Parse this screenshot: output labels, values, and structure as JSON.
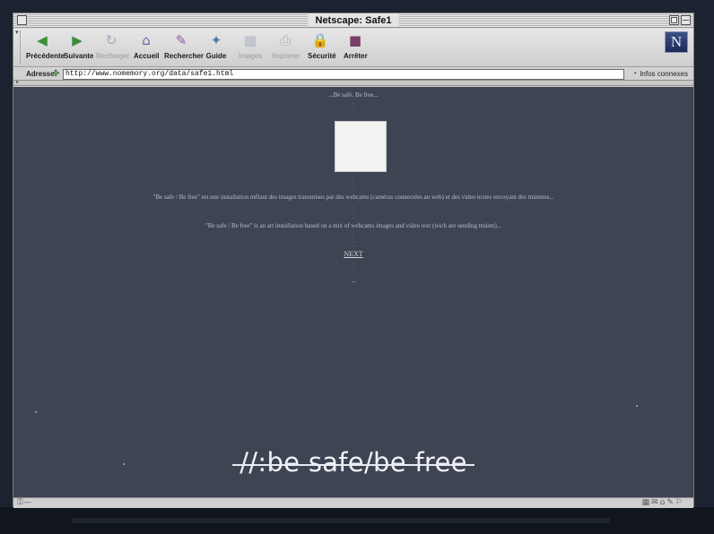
{
  "window": {
    "title": "Netscape: Safe1"
  },
  "toolbar": {
    "buttons": [
      {
        "label": "Précédente",
        "icon": "back-arrow-icon",
        "glyph": "◀"
      },
      {
        "label": "Suivante",
        "icon": "forward-arrow-icon",
        "glyph": "▶"
      },
      {
        "label": "Recharger",
        "icon": "reload-icon",
        "glyph": "↻"
      },
      {
        "label": "Accueil",
        "icon": "home-icon",
        "glyph": "⌂"
      },
      {
        "label": "Rechercher",
        "icon": "search-icon",
        "glyph": "✎"
      },
      {
        "label": "Guide",
        "icon": "guide-icon",
        "glyph": "✦"
      },
      {
        "label": "Images",
        "icon": "images-icon",
        "glyph": "▦"
      },
      {
        "label": "Imprimer",
        "icon": "print-icon",
        "glyph": "⎙"
      },
      {
        "label": "Sécurité",
        "icon": "security-lock-icon",
        "glyph": "🔒"
      },
      {
        "label": "Arrêter",
        "icon": "stop-icon",
        "glyph": "■"
      }
    ],
    "logo_letter": "N"
  },
  "location": {
    "label": "Adresse",
    "url": "http://www.nomemory.org/data/safe1.html",
    "related_label": "Infos connexes"
  },
  "content": {
    "header_text": "...Be safe. Be free...",
    "french_text": "\"Be safe / Be free\" est une installation mêlant des images transmises par des webcams (caméras connectées au web) et des video textes envoyant des truismes...",
    "english_text": "\"Be safe / Be free\" is an art installation based on a mix of webcams images and video text (wich are sending truism)...",
    "next_link": "NEXT",
    "tail_mark": "...",
    "big_title": "//:be safe/be free"
  },
  "colors": {
    "content_background": "#3d4452",
    "chrome": "#d6d6d6",
    "surround": "#1c2330"
  }
}
